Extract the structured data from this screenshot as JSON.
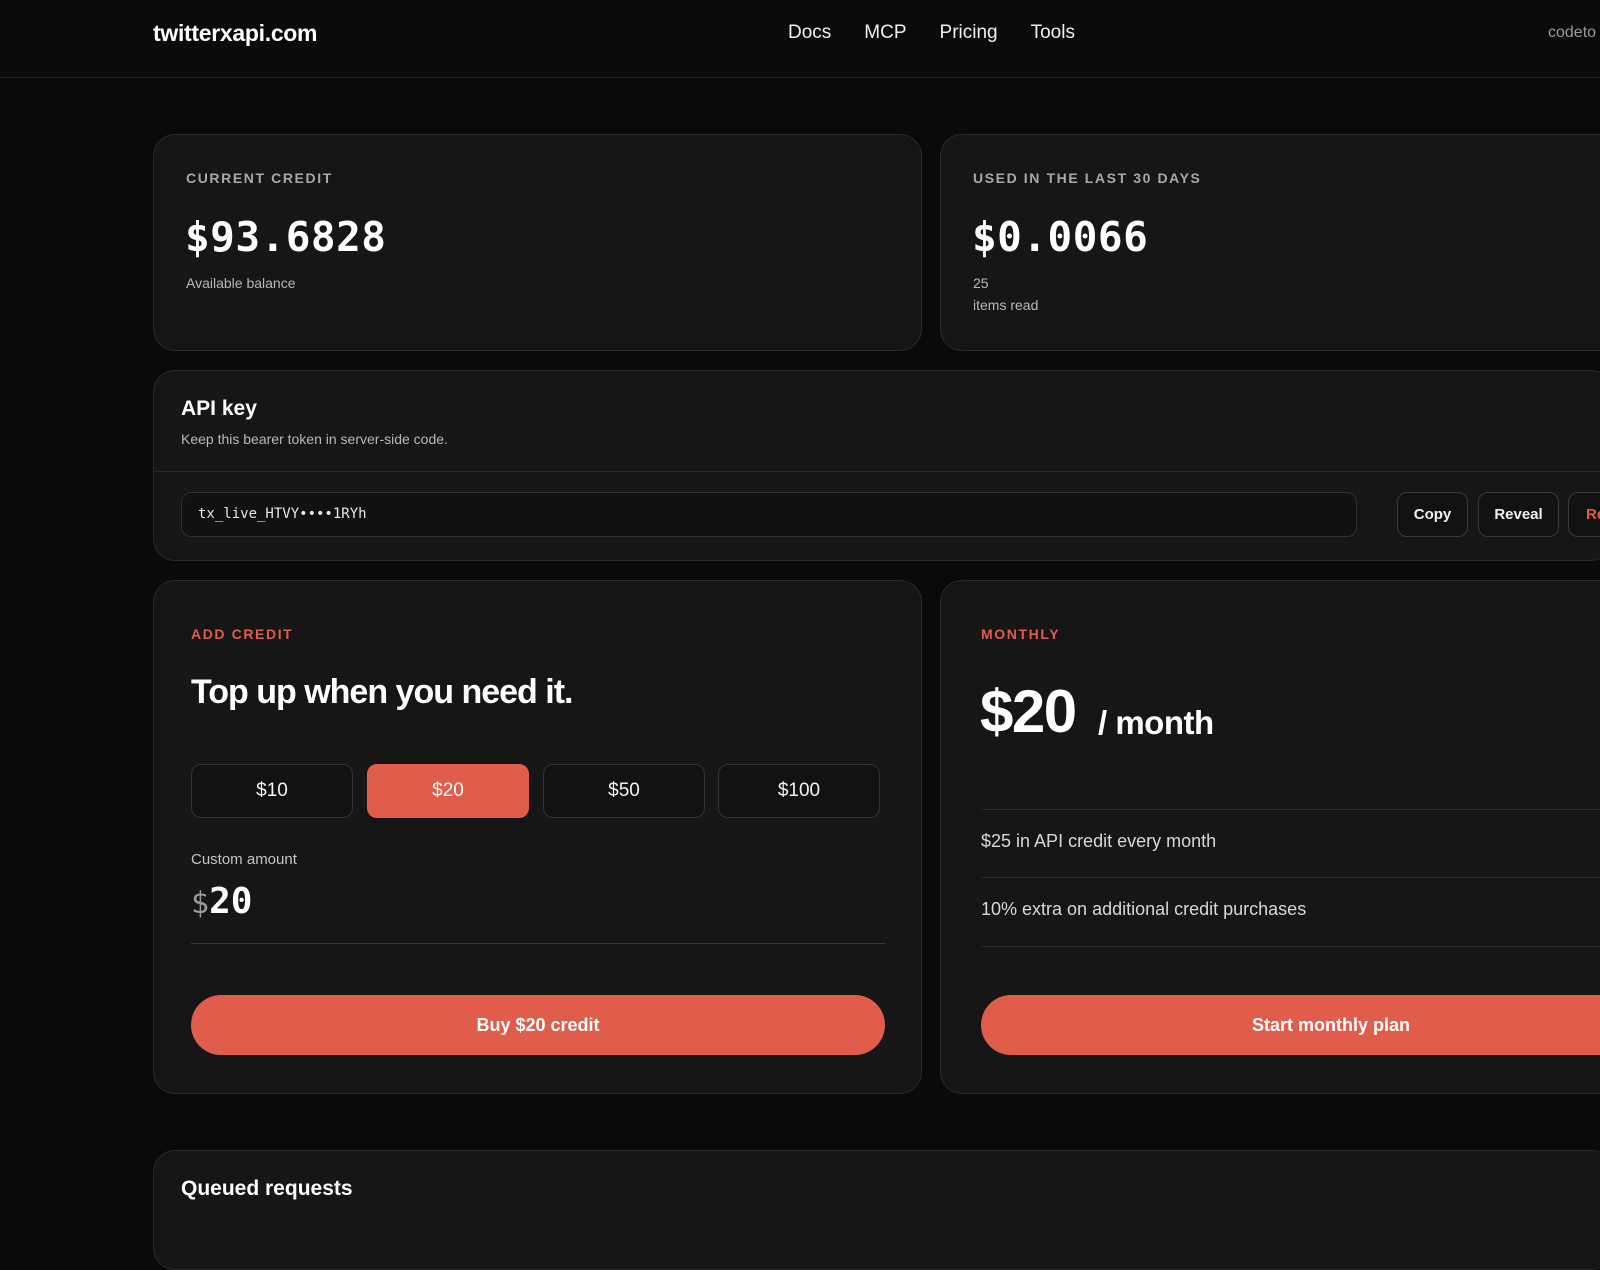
{
  "header": {
    "logo": "twitterxapi.com",
    "nav": [
      "Docs",
      "MCP",
      "Pricing",
      "Tools"
    ],
    "user": "codeto"
  },
  "credit": {
    "eyebrow": "CURRENT CREDIT",
    "amount": "$93.6828",
    "caption": "Available balance"
  },
  "usage": {
    "eyebrow": "USED IN THE LAST 30 DAYS",
    "amount": "$0.0066",
    "count": "25",
    "caption": "items read"
  },
  "api_key": {
    "title": "API key",
    "subtitle": "Keep this bearer token in server-side code.",
    "value": "tx_live_HTVY••••1RYh",
    "copy_label": "Copy",
    "reveal_label": "Reveal",
    "third_label": "Re"
  },
  "add_credit": {
    "eyebrow": "ADD CREDIT",
    "headline": "Top up when you need it.",
    "amounts": [
      "$10",
      "$20",
      "$50",
      "$100"
    ],
    "selected": "$20",
    "custom_label": "Custom amount",
    "custom_currency": "$",
    "custom_value": "20",
    "cta": "Buy $20 credit"
  },
  "monthly": {
    "eyebrow": "MONTHLY",
    "price": "$20",
    "unit": "/ month",
    "features": [
      "$25 in API credit every month",
      "10% extra on additional credit purchases"
    ],
    "cta": "Start monthly plan"
  },
  "queued": {
    "title": "Queued requests"
  },
  "colors": {
    "accent": "#e05d4b",
    "background": "#0a0a0a",
    "card": "#161616"
  }
}
